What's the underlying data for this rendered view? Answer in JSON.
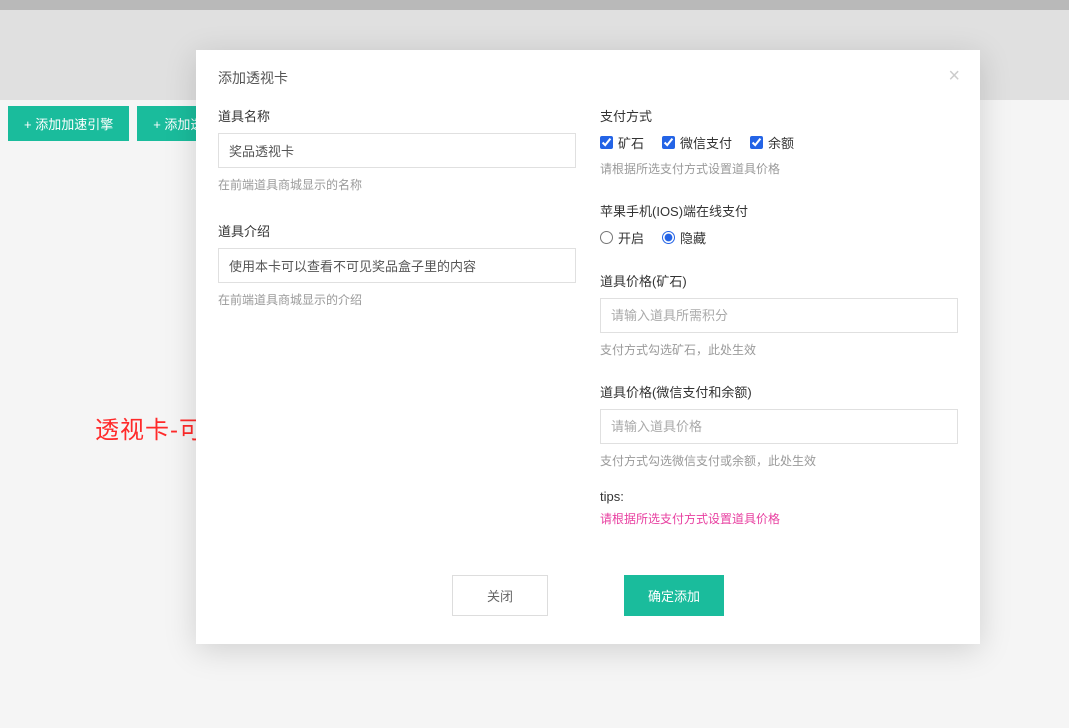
{
  "toolbar": {
    "buttons": [
      {
        "label": "+  添加加速引擎"
      },
      {
        "label": "+  添加透"
      }
    ]
  },
  "annotation": "透视卡-可以查看该盒子里的奖品",
  "modal": {
    "title": "添加透视卡",
    "left": {
      "name": {
        "label": "道具名称",
        "value": "奖品透视卡",
        "helper": "在前端道具商城显示的名称"
      },
      "intro": {
        "label": "道具介绍",
        "value": "使用本卡可以查看不可见奖品盒子里的内容",
        "helper": "在前端道具商城显示的介绍"
      }
    },
    "right": {
      "payment": {
        "label": "支付方式",
        "options": [
          {
            "label": "矿石",
            "checked": true
          },
          {
            "label": "微信支付",
            "checked": true
          },
          {
            "label": "余额",
            "checked": true
          }
        ],
        "helper": "请根据所选支付方式设置道具价格"
      },
      "ios": {
        "label": "苹果手机(IOS)端在线支付",
        "options": [
          {
            "label": "开启",
            "checked": false
          },
          {
            "label": "隐藏",
            "checked": true
          }
        ]
      },
      "price_ore": {
        "label": "道具价格(矿石)",
        "placeholder": "请输入道具所需积分",
        "helper": "支付方式勾选矿石，此处生效"
      },
      "price_wx": {
        "label": "道具价格(微信支付和余额)",
        "placeholder": "请输入道具价格",
        "helper": "支付方式勾选微信支付或余额，此处生效"
      },
      "tips": {
        "label": "tips:",
        "text": "请根据所选支付方式设置道具价格"
      }
    },
    "footer": {
      "cancel": "关闭",
      "confirm": "确定添加"
    }
  }
}
